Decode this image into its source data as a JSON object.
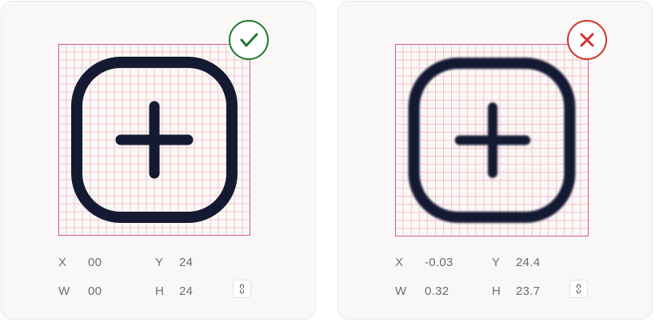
{
  "colors": {
    "card_background": "#f9f8f6",
    "grid_line": "#f3b6c4",
    "grid_border": "#d85a86",
    "icon_stroke": "#151a33",
    "correct_badge": "#1f7a2e",
    "incorrect_badge": "#d3302a",
    "text_muted": "#6b6b72"
  },
  "cards": [
    {
      "status": "correct",
      "badge_icon": "checkmark-icon",
      "icon": "plus-square-icon",
      "pixel_aligned": true,
      "props": {
        "x_label": "X",
        "x_value": "00",
        "y_label": "Y",
        "y_value": "24",
        "w_label": "W",
        "w_value": "00",
        "h_label": "H",
        "h_value": "24"
      },
      "lock_icon": "aspect-lock-icon"
    },
    {
      "status": "incorrect",
      "badge_icon": "cross-icon",
      "icon": "plus-square-icon",
      "pixel_aligned": false,
      "props": {
        "x_label": "X",
        "x_value": "-0.03",
        "y_label": "Y",
        "y_value": "24.4",
        "w_label": "W",
        "w_value": "0.32",
        "h_label": "H",
        "h_value": "23.7"
      },
      "lock_icon": "aspect-lock-icon"
    }
  ]
}
